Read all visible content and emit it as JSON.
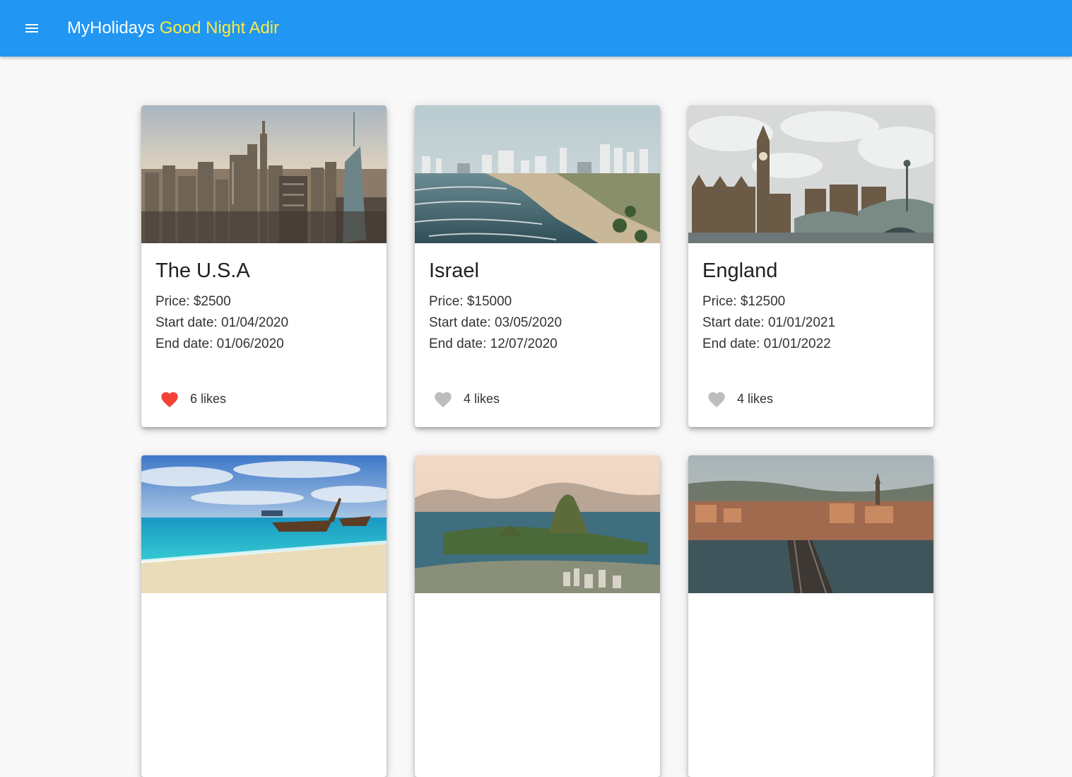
{
  "appbar": {
    "brand": "MyHolidays",
    "greeting": "Good Night Adir",
    "menu_icon": "hamburger-menu-icon",
    "color": "#2196f3",
    "greeting_color": "#ffeb3b"
  },
  "vacations": [
    {
      "destination": "The U.S.A",
      "price": "Price: $2500",
      "start": "Start date: 01/04/2020",
      "end": "End date: 01/06/2020",
      "likes": "6 likes",
      "liked": true,
      "image": "new-york-skyline-photo"
    },
    {
      "destination": "Israel",
      "price": "Price: $15000",
      "start": "Start date: 03/05/2020",
      "end": "End date: 12/07/2020",
      "likes": "4 likes",
      "liked": false,
      "image": "tel-aviv-beach-photo"
    },
    {
      "destination": "England",
      "price": "Price: $12500",
      "start": "Start date: 01/01/2021",
      "end": "End date: 01/01/2022",
      "likes": "4 likes",
      "liked": false,
      "image": "big-ben-westminster-photo"
    },
    {
      "destination": "",
      "image": "tropical-beach-longtail-boat-photo"
    },
    {
      "destination": "",
      "image": "rio-sugarloaf-mountain-photo"
    },
    {
      "destination": "",
      "image": "prague-charles-bridge-photo"
    }
  ],
  "colors": {
    "liked_heart": "#f44336",
    "unliked_heart": "#bdbdbd"
  }
}
